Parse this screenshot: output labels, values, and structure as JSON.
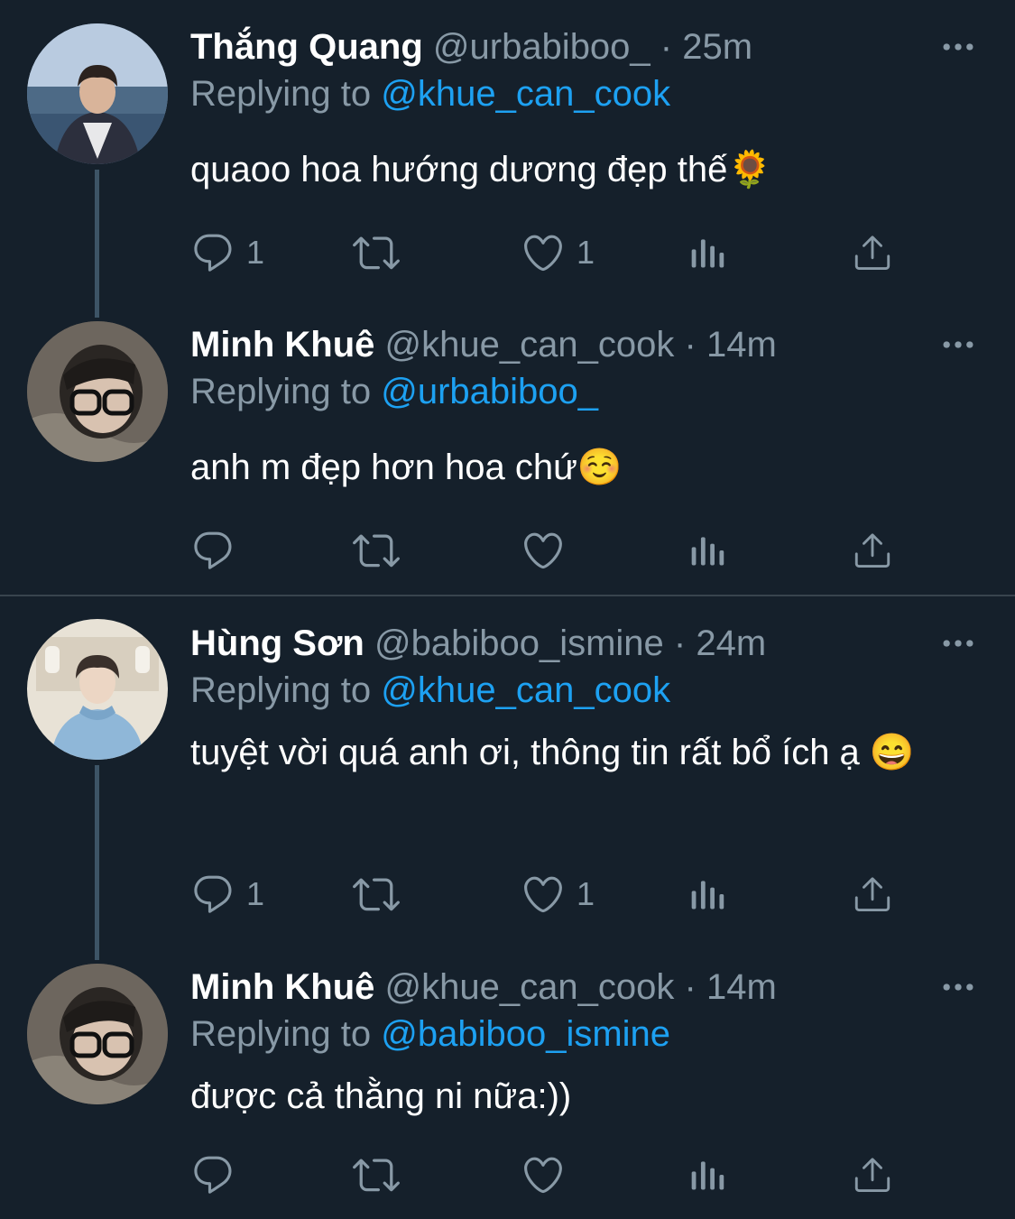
{
  "colors": {
    "background": "#15202b",
    "primary_text": "#ffffff",
    "secondary_text": "#8899a6",
    "mention": "#1da1f2",
    "thread_line": "#3d5466",
    "divider": "#38444d"
  },
  "tweets": [
    {
      "name": "Thắng Quang",
      "handle": "@urbabiboo_",
      "separator": "·",
      "time": "25m",
      "replying_label": "Replying to",
      "replying_to": "@khue_can_cook",
      "text": "quaoo hoa hướng dương đẹp thế🌻",
      "reply_count": "1",
      "like_count": "1",
      "icons": [
        "reply-icon",
        "retweet-icon",
        "like-icon",
        "analytics-icon",
        "share-icon",
        "more-icon"
      ]
    },
    {
      "name": "Minh Khuê",
      "handle": "@khue_can_cook",
      "separator": "·",
      "time": "14m",
      "replying_label": "Replying to",
      "replying_to": "@urbabiboo_",
      "text": "anh m đẹp hơn hoa chứ☺️",
      "reply_count": "",
      "like_count": "",
      "icons": [
        "reply-icon",
        "retweet-icon",
        "like-icon",
        "analytics-icon",
        "share-icon",
        "more-icon"
      ]
    },
    {
      "name": "Hùng Sơn",
      "handle": "@babiboo_ismine",
      "separator": "·",
      "time": "24m",
      "replying_label": "Replying to",
      "replying_to": "@khue_can_cook",
      "text": "tuyệt vời quá anh ơi, thông tin rất bổ ích ạ 😄",
      "reply_count": "1",
      "like_count": "1",
      "icons": [
        "reply-icon",
        "retweet-icon",
        "like-icon",
        "analytics-icon",
        "share-icon",
        "more-icon"
      ]
    },
    {
      "name": "Minh Khuê",
      "handle": "@khue_can_cook",
      "separator": "·",
      "time": "14m",
      "replying_label": "Replying to",
      "replying_to": "@babiboo_ismine",
      "text": "được cả thằng ni nữa:))",
      "reply_count": "",
      "like_count": "",
      "icons": [
        "reply-icon",
        "retweet-icon",
        "like-icon",
        "analytics-icon",
        "share-icon",
        "more-icon"
      ]
    }
  ]
}
